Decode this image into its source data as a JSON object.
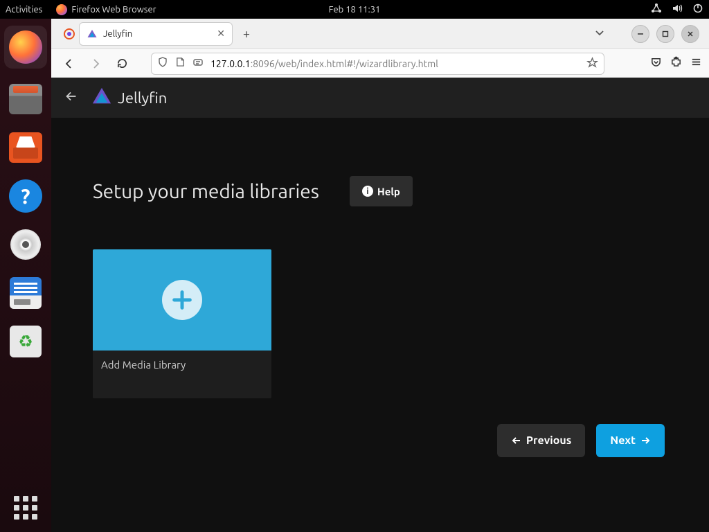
{
  "top_panel": {
    "activities": "Activities",
    "app_label": "Firefox Web Browser",
    "clock": "Feb 18  11:31"
  },
  "browser": {
    "tab_title": "Jellyfin",
    "url_host": "127.0.0.1",
    "url_path": ":8096/web/index.html#!/wizardlibrary.html"
  },
  "jellyfin": {
    "brand": "Jellyfin",
    "page_title": "Setup your media libraries",
    "help_label": "Help",
    "card_label": "Add Media Library",
    "previous": "Previous",
    "next": "Next"
  }
}
